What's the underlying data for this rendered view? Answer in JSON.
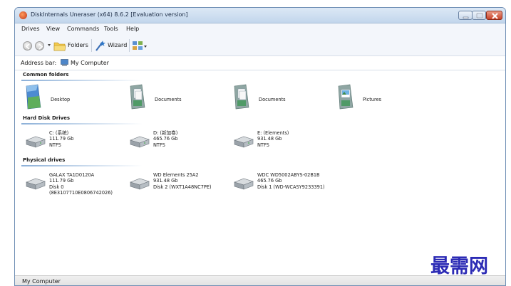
{
  "window": {
    "title": "DiskInternals Uneraser (x64) 8.6.2 [Evaluation version]"
  },
  "menubar": {
    "items": [
      {
        "label": "Drives"
      },
      {
        "label": "View"
      },
      {
        "label": "Commands"
      },
      {
        "label": "Tools"
      },
      {
        "label": "Help"
      }
    ]
  },
  "toolbar": {
    "back_icon": "back-arrow-icon",
    "forward_icon": "forward-arrow-icon",
    "folders_label": "Folders",
    "wizard_label": "Wizard",
    "view_icon": "view-mode-icon"
  },
  "address": {
    "label": "Address bar:",
    "value": "My Computer"
  },
  "sections": {
    "common_folders": {
      "title": "Common folders",
      "items": [
        {
          "name": "Desktop",
          "icon": "desktop-folder-icon"
        },
        {
          "name": "Documents",
          "icon": "documents-folder-icon"
        },
        {
          "name": "Documents",
          "icon": "documents-folder-icon"
        },
        {
          "name": "Pictures",
          "icon": "pictures-folder-icon"
        }
      ]
    },
    "hard_disk_drives": {
      "title": "Hard Disk Drives",
      "items": [
        {
          "name": "C: (系统)",
          "size": "111.79 Gb",
          "fs": "NTFS",
          "icon": "hard-drive-icon"
        },
        {
          "name": "D: (新加卷)",
          "size": "465.76 Gb",
          "fs": "NTFS",
          "icon": "hard-drive-icon"
        },
        {
          "name": "E: (Elements)",
          "size": "931.48 Gb",
          "fs": "NTFS",
          "icon": "hard-drive-icon"
        }
      ]
    },
    "physical_drives": {
      "title": "Physical drives",
      "items": [
        {
          "name": "GALAX TA1D0120A",
          "size": "111.79 Gb",
          "disk": "Disk 0",
          "serial": "(8E3107710E0806742026)",
          "icon": "physical-drive-icon"
        },
        {
          "name": "WD Elements 25A2",
          "size": "931.48 Gb",
          "disk": "Disk 2 (WXT1A48NC7PE)",
          "icon": "physical-drive-icon"
        },
        {
          "name": "WDC WD5002ABYS-02B1B",
          "size": "465.76 Gb",
          "disk": "Disk 1 (WD-WCASY9233391)",
          "icon": "physical-drive-icon"
        }
      ]
    }
  },
  "statusbar": {
    "text": "My Computer"
  },
  "watermark": {
    "text": "最需网"
  },
  "colors": {
    "title_gradient_top": "#dce8f5",
    "title_gradient_bottom": "#c2d6ec",
    "section_line": "#8cb0d8",
    "close_button": "#c6432b",
    "watermark": "#2c2bb5"
  }
}
